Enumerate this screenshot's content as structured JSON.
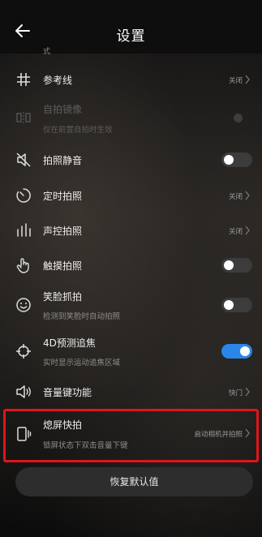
{
  "header": {
    "title": "设置",
    "back_icon": "arrow-left-icon"
  },
  "cut_row_text": "式",
  "rows": {
    "grid": {
      "label": "参考线",
      "value": "关闭",
      "icon": "grid-icon"
    },
    "mirror": {
      "label": "自拍镜像",
      "sub": "仅在前置自拍时生效",
      "icon": "mirror-icon",
      "disabled": true
    },
    "mute": {
      "label": "拍照静音",
      "icon": "speaker-mute-icon",
      "toggle": false
    },
    "timer": {
      "label": "定时拍照",
      "value": "关闭",
      "icon": "timer-icon"
    },
    "voice": {
      "label": "声控拍照",
      "value": "关闭",
      "icon": "audio-bars-icon"
    },
    "touch": {
      "label": "触摸拍照",
      "icon": "touch-hand-icon",
      "toggle": false
    },
    "smile": {
      "label": "笑脸抓拍",
      "sub": "检测到笑脸时自动拍照",
      "icon": "smile-icon",
      "toggle": false
    },
    "focus4d": {
      "label": "4D预测追焦",
      "sub": "实时显示运动追焦区域",
      "icon": "focus-target-icon",
      "toggle": true
    },
    "volume": {
      "label": "音量键功能",
      "value": "快门",
      "icon": "volume-key-icon"
    },
    "snapshot": {
      "label": "熄屏快拍",
      "sub": "锁屏状态下双击音量下键",
      "value": "启动相机并拍照",
      "icon": "screen-off-icon"
    }
  },
  "reset_button": {
    "label": "恢复默认值"
  },
  "colors": {
    "accent": "#2a86e8",
    "highlight_border": "#e0141c",
    "background": "#0c0c0c"
  }
}
